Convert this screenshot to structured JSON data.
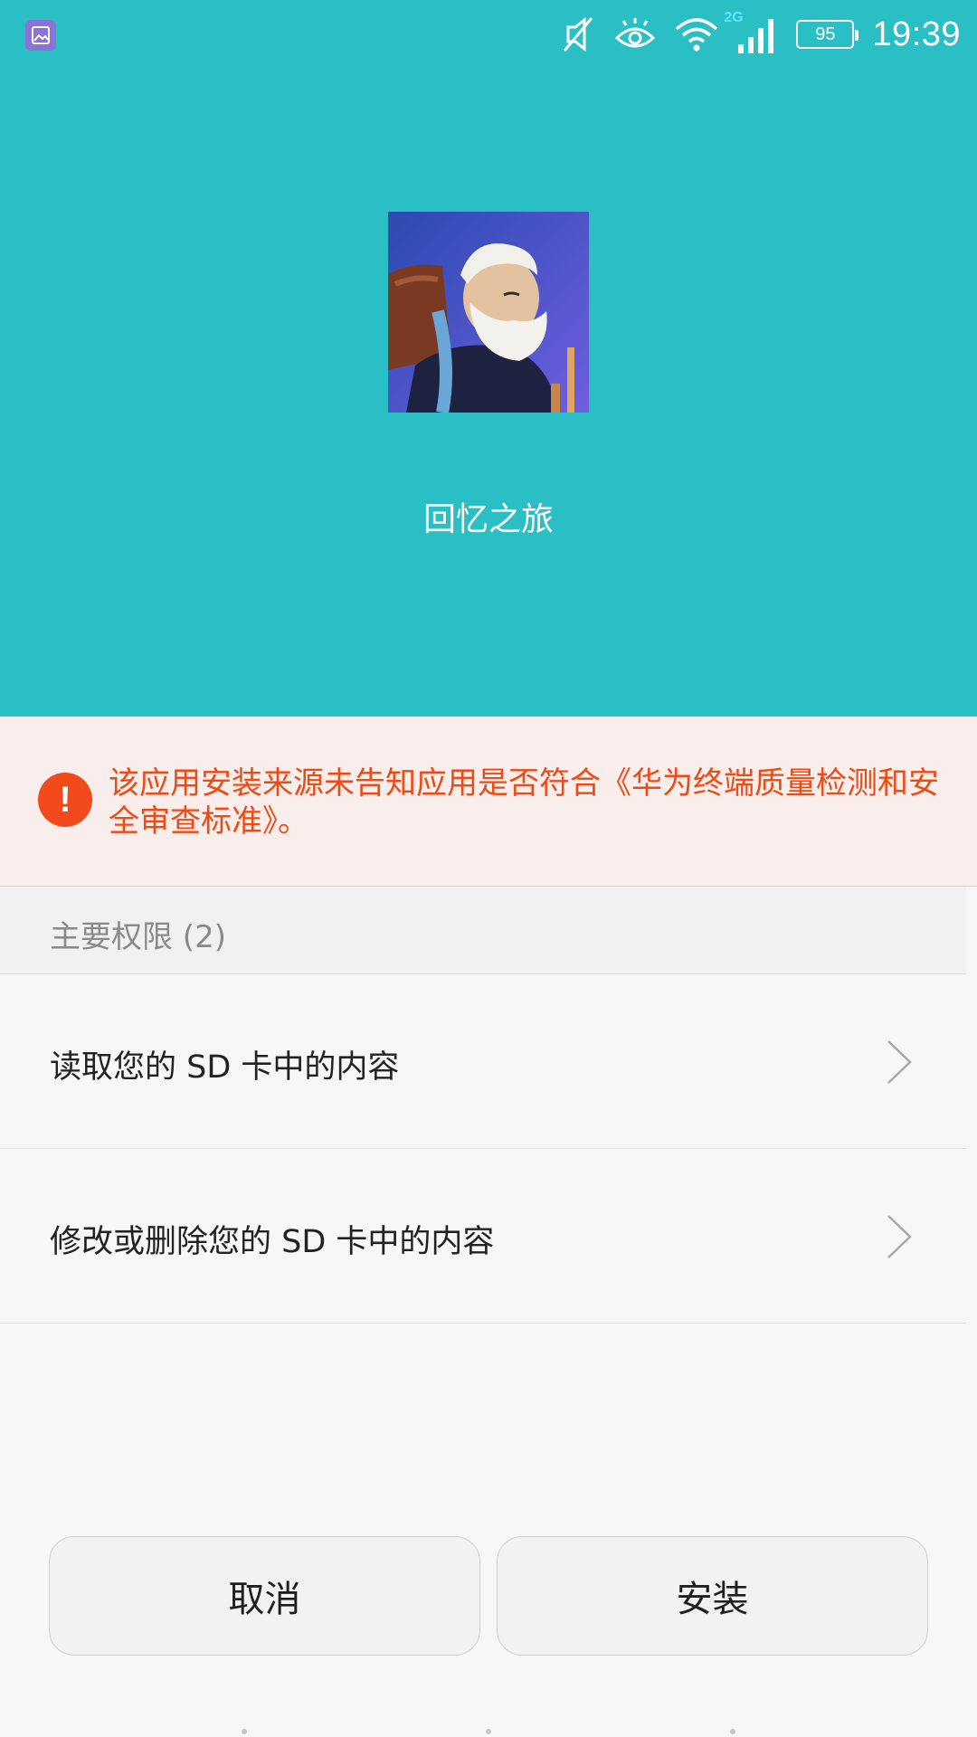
{
  "status_bar": {
    "network_label": "2G",
    "battery_level": "95",
    "time": "19:39",
    "icons": [
      "gallery-notification-icon",
      "mute-icon",
      "eye-comfort-icon",
      "wifi-icon",
      "signal-icon",
      "battery-icon"
    ]
  },
  "app": {
    "name": "回忆之旅"
  },
  "warning": {
    "text": "该应用安装来源未告知应用是否符合《华为终端质量检测和安全审查标准》。",
    "accent_color": "#ef4a14"
  },
  "permissions": {
    "header": "主要权限 (2)",
    "items": [
      {
        "label": "读取您的 SD 卡中的内容"
      },
      {
        "label": "修改或删除您的 SD 卡中的内容"
      }
    ]
  },
  "buttons": {
    "cancel": "取消",
    "install": "安装"
  },
  "colors": {
    "header_bg": "#2abfc5",
    "warning_bg": "#faeeec",
    "page_bg": "#f7f7f7"
  }
}
